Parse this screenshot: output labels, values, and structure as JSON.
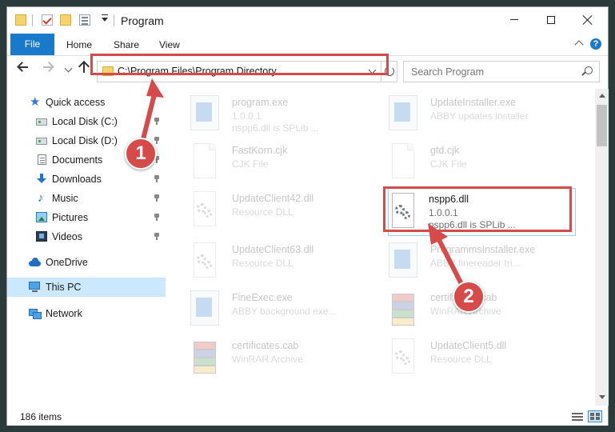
{
  "window": {
    "title": "Program",
    "controls": {
      "minimize": "minimize",
      "maximize": "maximize",
      "close": "close"
    }
  },
  "ribbon": {
    "tabs": [
      "File",
      "Home",
      "Share",
      "View"
    ]
  },
  "address": {
    "path": "C:\\Program Files\\Program Directory"
  },
  "search": {
    "placeholder": "Search Program"
  },
  "sidebar": {
    "items": [
      {
        "label": "Quick access",
        "icon": "star-icon"
      },
      {
        "label": "Local Disk (C:)",
        "icon": "disk-icon",
        "pinned": true
      },
      {
        "label": "Local Disk (D:)",
        "icon": "disk-icon",
        "pinned": true
      },
      {
        "label": "Documents",
        "icon": "documents-icon",
        "pinned": true
      },
      {
        "label": "Downloads",
        "icon": "downloads-icon",
        "pinned": true
      },
      {
        "label": "Music",
        "icon": "music-icon",
        "pinned": true
      },
      {
        "label": "Pictures",
        "icon": "pictures-icon",
        "pinned": true
      },
      {
        "label": "Videos",
        "icon": "videos-icon",
        "pinned": true
      },
      {
        "label": "OneDrive",
        "icon": "onedrive-icon"
      },
      {
        "label": "This PC",
        "icon": "this-pc-icon",
        "selected": true
      },
      {
        "label": "Network",
        "icon": "network-icon"
      }
    ]
  },
  "files": [
    {
      "name": "program.exe",
      "line2": "1.0.0.1",
      "line3": "nspp6.dll is SPLib ...",
      "icon": "app-icon"
    },
    {
      "name": "UpdateInstaller.exe",
      "line2": "ABBY updates installer",
      "line3": "",
      "icon": "app-icon"
    },
    {
      "name": "FastKorn.cjk",
      "line2": "CJK File",
      "line3": "",
      "icon": "file-icon"
    },
    {
      "name": "gtd.cjk",
      "line2": "CJK File",
      "line3": "",
      "icon": "file-icon"
    },
    {
      "name": "UpdateClient42.dll",
      "line2": "Resource DLL",
      "line3": "",
      "icon": "dll-icon"
    },
    {
      "name": "nspp6.dll",
      "line2": "1.0.0.1",
      "line3": "nspp6.dll is SPLib ...",
      "icon": "dll-icon",
      "selected": true
    },
    {
      "name": "UpdateClient63.dll",
      "line2": "Resource DLL",
      "line3": "",
      "icon": "dll-icon"
    },
    {
      "name": "ProgrammsInstaller.exe",
      "line2": "ABBY finereader tri...",
      "line3": "",
      "icon": "app-icon"
    },
    {
      "name": "FineExec.exe",
      "line2": "ABBY background exe...",
      "line3": "",
      "icon": "app-icon"
    },
    {
      "name": "certificates.cab",
      "line2": "WinRAR Archive",
      "line3": "",
      "icon": "winrar-icon"
    },
    {
      "name": "certificates.cab",
      "line2": "WinRAR Archive",
      "line3": "",
      "icon": "winrar-icon"
    },
    {
      "name": "UpdateClient5.dll",
      "line2": "Resource DLL",
      "line3": "",
      "icon": "dll-icon"
    }
  ],
  "status": {
    "item_count": "186 items"
  },
  "annotations": [
    {
      "number": "1"
    },
    {
      "number": "2"
    }
  ],
  "colors": {
    "accent": "#1979ca",
    "annotation": "#d64a4a",
    "selection": "#cce8ff"
  }
}
